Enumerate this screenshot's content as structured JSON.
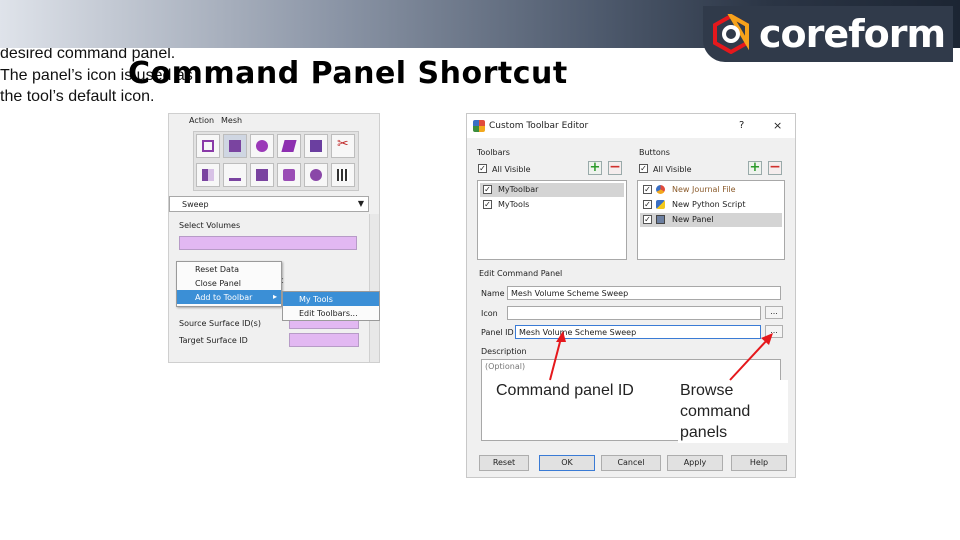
{
  "slide": {
    "title": "Command Panel Shortcut",
    "brand": "coreform",
    "colors": {
      "accent_red": "#e5181c",
      "band_dark": "#2b3545",
      "field_purple": "#e2b8f2",
      "menu_highlight": "#3b8fd6"
    }
  },
  "command_panel": {
    "tabs": [
      "Action",
      "Mesh"
    ],
    "dropdown_value": "Sweep",
    "select_volumes_label": "Select Volumes",
    "target_label": "rget",
    "source_surface_label": "Source Surface ID(s)",
    "target_surface_label": "Target Surface ID",
    "context_menu": [
      "Reset Data",
      "Close Panel",
      "Add to Toolbar"
    ],
    "submenu": [
      "My Tools",
      "Edit Toolbars..."
    ]
  },
  "editor": {
    "title": "Custom Toolbar Editor",
    "help": "?",
    "close": "×",
    "toolbars_group": "Toolbars",
    "buttons_group": "Buttons",
    "all_visible": "All Visible",
    "toolbars": [
      "MyToolbar",
      "MyTools"
    ],
    "buttons": [
      "New Journal File",
      "New Python Script",
      "New Panel"
    ],
    "edit_group": "Edit Command Panel",
    "name_label": "Name",
    "name_value": "Mesh Volume Scheme Sweep",
    "icon_label": "Icon",
    "panel_id_label": "Panel ID",
    "panel_id_value": "Mesh Volume Scheme Sweep",
    "description_label": "Description",
    "description_placeholder": "(Optional)",
    "dots": "...",
    "footer_buttons": [
      "Reset",
      "OK",
      "Cancel",
      "Apply",
      "Help"
    ]
  },
  "annotations": {
    "left_caption": "Can create by right clicking on a blank area of the desired command panel. The panel’s icon is used as the tool’s default icon.",
    "panel_id_note": "Command panel ID",
    "browse_note": "Browse command panels"
  }
}
